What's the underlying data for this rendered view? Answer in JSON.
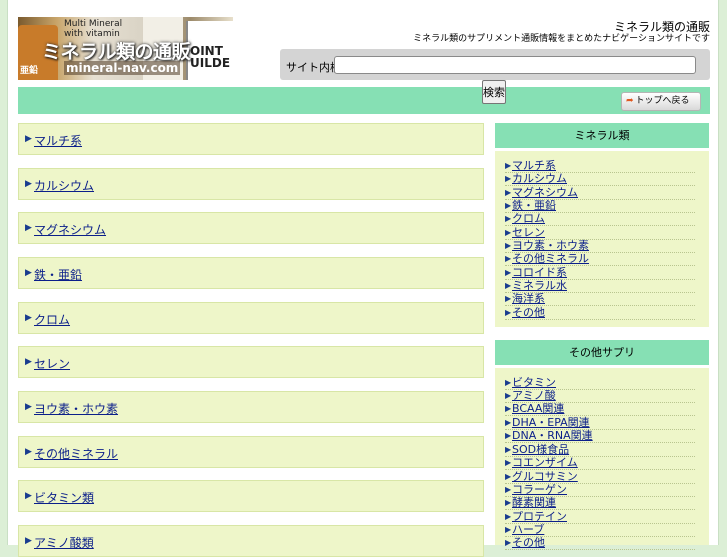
{
  "header": {
    "logo": {
      "top_text": "Multi Mineral\nwith vitamin",
      "main_text": "ミネラル類の通販",
      "url_text": "mineral-nav.com",
      "side_text": "亜鉛",
      "joint_text": "OINT\nUILDE"
    },
    "site_title": "ミネラル類の通販",
    "site_description": "ミネラル類のサプリメント通販情報をまとめたナビゲーションサイトです",
    "search": {
      "label": "サイト内検索",
      "value": "",
      "placeholder": "",
      "button_label": "検索"
    },
    "top_link_label": "トップへ戻る"
  },
  "main": {
    "items": [
      {
        "label": "マルチ系"
      },
      {
        "label": "カルシウム"
      },
      {
        "label": "マグネシウム"
      },
      {
        "label": "鉄・亜鉛"
      },
      {
        "label": "クロム"
      },
      {
        "label": "セレン"
      },
      {
        "label": "ヨウ素・ホウ素"
      },
      {
        "label": "その他ミネラル"
      },
      {
        "label": "ビタミン類"
      },
      {
        "label": "アミノ酸類"
      }
    ]
  },
  "sidebar": {
    "sections": [
      {
        "title": "ミネラル類",
        "items": [
          {
            "label": "マルチ系"
          },
          {
            "label": "カルシウム"
          },
          {
            "label": "マグネシウム"
          },
          {
            "label": "鉄・亜鉛"
          },
          {
            "label": "クロム"
          },
          {
            "label": "セレン"
          },
          {
            "label": "ヨウ素・ホウ素"
          },
          {
            "label": "その他ミネラル"
          },
          {
            "label": "コロイド系"
          },
          {
            "label": "ミネラル水"
          },
          {
            "label": "海洋系"
          },
          {
            "label": "その他"
          }
        ]
      },
      {
        "title": "その他サプリ",
        "items": [
          {
            "label": "ビタミン"
          },
          {
            "label": "アミノ酸"
          },
          {
            "label": "BCAA関連"
          },
          {
            "label": "DHA・EPA関連"
          },
          {
            "label": "DNA・RNA関連"
          },
          {
            "label": "SOD様食品"
          },
          {
            "label": "コエンザイム"
          },
          {
            "label": "グルコサミン"
          },
          {
            "label": "コラーゲン"
          },
          {
            "label": "酵素関連"
          },
          {
            "label": "プロテイン"
          },
          {
            "label": "ハーブ"
          },
          {
            "label": "その他"
          }
        ]
      }
    ]
  },
  "colors": {
    "nav_green": "#86e0b4",
    "item_bg": "#eef6c9",
    "link": "#0b1f8a"
  }
}
